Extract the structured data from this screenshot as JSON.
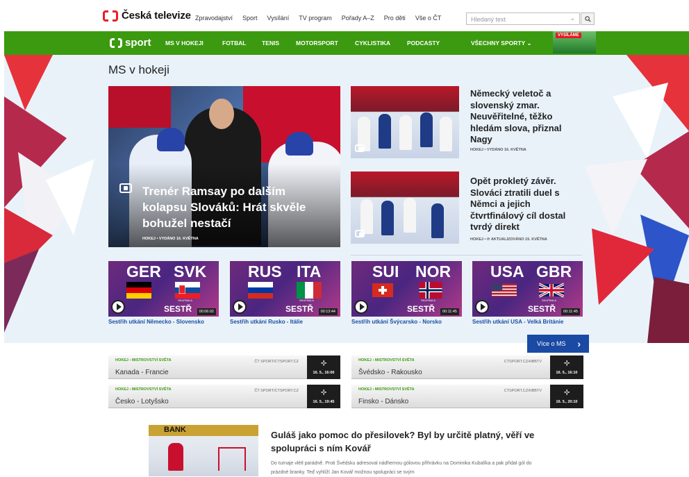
{
  "header": {
    "brand": "Česká televize",
    "nav": [
      "Zpravodajství",
      "Sport",
      "Vysílání",
      "TV program",
      "Pořady A–Z",
      "Pro děti",
      "Vše o ČT"
    ],
    "search_placeholder": "Hledaný text"
  },
  "sport_nav": {
    "brand": "sport",
    "items": [
      "MS V HOKEJI",
      "FOTBAL",
      "TENIS",
      "MOTORSPORT",
      "CYKLISTIKA",
      "PODCASTY",
      "VŠECHNY SPORTY"
    ],
    "live_label": "VYSÍLÁME"
  },
  "page": {
    "title": "MS v hokeji"
  },
  "main_story": {
    "headline": "Trenér Ramsay po dalším kolapsu Slováků: Hrát skvěle bohužel nestačí",
    "meta": "HOKEJ • VYDÁNO 16. KVĚTNA"
  },
  "side_stories": [
    {
      "headline": "Německý veletoč a slovenský zmar. Neuvěřitelné, těžko hledám slova, přiznal Nagy",
      "meta": "HOKEJ • VYDÁNO 16. KVĚTNA"
    },
    {
      "headline": "Opět prokletý závěr. Slováci ztratili duel s Němci a jejich čtvrtfinálový cíl dostal tvrdý direkt",
      "meta": "HOKEJ • ⟳ AKTUALIZOVÁNO 15. KVĚTNA"
    }
  ],
  "videos": [
    {
      "home": "GER",
      "away": "SVK",
      "duration": "00:06:02",
      "caption": "Sestřih utkání Německo - Slovensko"
    },
    {
      "home": "RUS",
      "away": "ITA",
      "duration": "00:13:44",
      "caption": "Sestřih utkání Rusko - Itálie"
    },
    {
      "home": "SUI",
      "away": "NOR",
      "duration": "00:11:45",
      "caption": "Sestřih utkání Švýcarsko - Norsko"
    },
    {
      "home": "USA",
      "away": "GBR",
      "duration": "00:11:45",
      "caption": "Sestřih utkání USA - Velká Británie"
    }
  ],
  "video_overlay": {
    "sestr": "SESTŘ",
    "sub": "SKUPINA A"
  },
  "more_button": "Více o MS",
  "matches": [
    {
      "crumb": "HOKEJ  ›  MISTROVSTVÍ SVĚTA",
      "teams": "Kanada - Francie",
      "channel": "ČT SPORT/CTSPORT.CZ",
      "time": "16. 5., 16:00"
    },
    {
      "crumb": "HOKEJ  ›  MISTROVSTVÍ SVĚTA",
      "teams": "Švédsko - Rakousko",
      "channel": "CTSPORT.CZ/HBBTV",
      "time": "16. 5., 16:10"
    },
    {
      "crumb": "HOKEJ  ›  MISTROVSTVÍ SVĚTA",
      "teams": "Česko - Lotyšsko",
      "channel": "ČT SPORT/CTSPORT.CZ",
      "time": "16. 5., 19:45"
    },
    {
      "crumb": "HOKEJ  ›  MISTROVSTVÍ SVĚTA",
      "teams": "Finsko - Dánsko",
      "channel": "CTSPORT.CZ/HBBTV",
      "time": "16. 5., 20:10"
    }
  ],
  "article": {
    "banner": "BANK",
    "title": "Guláš jako pomoc do přesilovek? Byl by určitě platný, věří ve spolupráci s ním Kovář",
    "text": "Do turnaje vlétl parádně. Proti Švédsku adresoval nádhernou gólovou přihrávku na Dominika Kubalíka a pak přidal gól do prázdné branky. Teď vyhlíží Jan Kovář možnou spolupráci se svým"
  },
  "colors": {
    "green": "#3b9a0f",
    "blue": "#1a4aa3",
    "red": "#ed1c24"
  }
}
